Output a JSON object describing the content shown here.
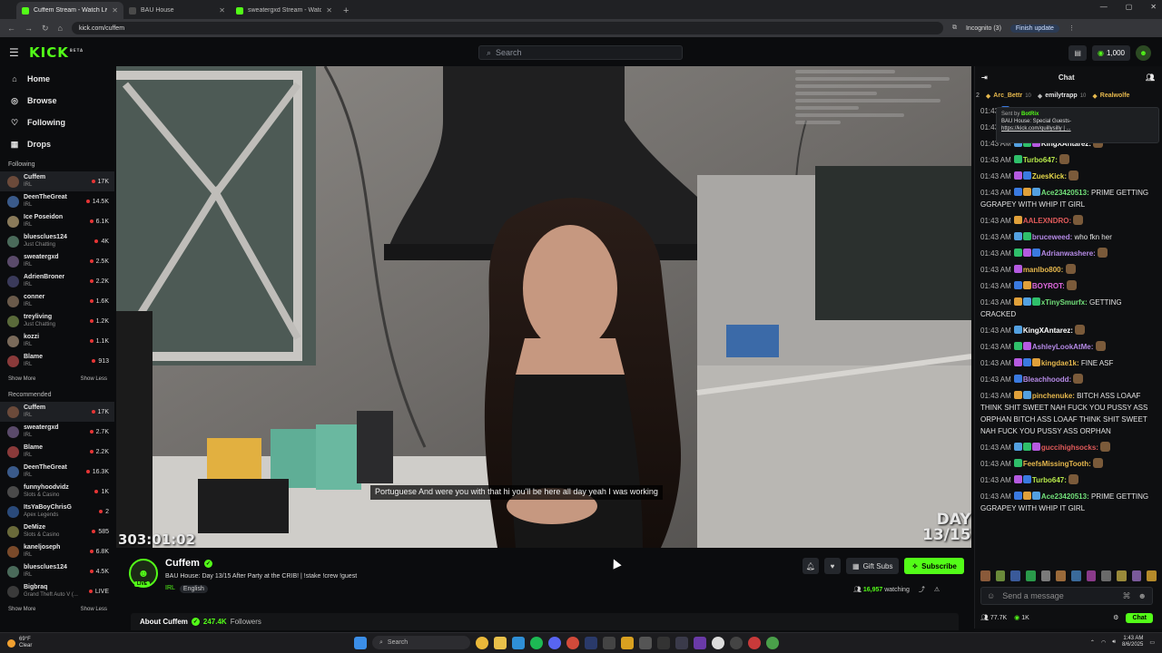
{
  "browser": {
    "tabs": [
      {
        "title": "Cuffem Stream - Watch Liv",
        "active": true
      },
      {
        "title": "BAU House",
        "active": false
      },
      {
        "title": "sweatergxd Stream - Watch Liv",
        "active": false
      }
    ],
    "url": "kick.com/cuffem",
    "incognito": "Incognito (3)",
    "update": "Finish update"
  },
  "header": {
    "logo": "KICK",
    "logo_sup": "BETA",
    "search_placeholder": "Search",
    "coins": "1,000"
  },
  "sidebar": {
    "nav": [
      {
        "label": "Home",
        "icon": "home-icon"
      },
      {
        "label": "Browse",
        "icon": "compass-icon"
      },
      {
        "label": "Following",
        "icon": "heart-icon"
      },
      {
        "label": "Drops",
        "icon": "gift-icon"
      }
    ],
    "following_title": "Following",
    "following": [
      {
        "name": "Cuffem",
        "category": "IRL",
        "viewers": "17K",
        "color": "#6b4a3a"
      },
      {
        "name": "DeenTheGreat",
        "category": "IRL",
        "viewers": "14.5K",
        "color": "#3a5a8a"
      },
      {
        "name": "Ice Poseidon",
        "category": "IRL",
        "viewers": "6.1K",
        "color": "#8a7a5a"
      },
      {
        "name": "bluesclues124",
        "category": "Just Chatting",
        "viewers": "4K",
        "color": "#4a6a5a"
      },
      {
        "name": "sweatergxd",
        "category": "IRL",
        "viewers": "2.5K",
        "color": "#5a4a6a"
      },
      {
        "name": "AdrienBroner",
        "category": "IRL",
        "viewers": "2.2K",
        "color": "#3a3a5a"
      },
      {
        "name": "conner",
        "category": "IRL",
        "viewers": "1.6K",
        "color": "#6a5a4a"
      },
      {
        "name": "treyliving",
        "category": "Just Chatting",
        "viewers": "1.2K",
        "color": "#5a6a3a"
      },
      {
        "name": "kozzi",
        "category": "IRL",
        "viewers": "1.1K",
        "color": "#7a6a5a"
      },
      {
        "name": "Blame",
        "category": "IRL",
        "viewers": "913",
        "color": "#8a3a3a"
      }
    ],
    "show_more": "Show More",
    "show_less": "Show Less",
    "recommended_title": "Recommended",
    "recommended": [
      {
        "name": "Cuffem",
        "category": "IRL",
        "viewers": "17K",
        "color": "#6b4a3a"
      },
      {
        "name": "sweatergxd",
        "category": "IRL",
        "viewers": "2.7K",
        "color": "#5a4a6a"
      },
      {
        "name": "Blame",
        "category": "IRL",
        "viewers": "2.2K",
        "color": "#8a3a3a"
      },
      {
        "name": "DeenTheGreat",
        "category": "IRL",
        "viewers": "16.3K",
        "color": "#3a5a8a"
      },
      {
        "name": "funnyhoodvidz",
        "category": "Slots & Casino",
        "viewers": "1K",
        "color": "#4a4a4a"
      },
      {
        "name": "ItsYaBoyChrisG",
        "category": "Apex Legends",
        "viewers": "2",
        "color": "#2a4a7a"
      },
      {
        "name": "DeMize",
        "category": "Slots & Casino",
        "viewers": "585",
        "color": "#6a6a3a"
      },
      {
        "name": "kaneljoseph",
        "category": "IRL",
        "viewers": "6.8K",
        "color": "#7a4a2a"
      },
      {
        "name": "bluesclues124",
        "category": "IRL",
        "viewers": "4.5K",
        "color": "#4a6a5a"
      },
      {
        "name": "Bigbraq",
        "category": "Grand Theft Auto V (...",
        "viewers": "LIVE",
        "color": "#3a3a3a"
      }
    ]
  },
  "video": {
    "caption": "Portuguese And were you with that hi you'll be here all day yeah I was working",
    "timer": "303:01:02",
    "day_overlay": [
      "DAY",
      "13/15"
    ]
  },
  "stream": {
    "name": "Cuffem",
    "live_badge": "LIVE",
    "title": "BAU House: Day 13/15 After Party at the CRIB! | !stake !crew !guest",
    "category": "IRL",
    "language": "English",
    "gift_subs": "Gift Subs",
    "subscribe": "Subscribe",
    "watching_count": "16,957",
    "watching_label": "watching",
    "about_label": "About Cuffem",
    "followers_count": "247.4K",
    "followers_label": "Followers"
  },
  "chat": {
    "title": "Chat",
    "gifter_rank": "2",
    "gifters": [
      {
        "name": "Arc_Bettr",
        "count": "10",
        "color": "#e6b84d"
      },
      {
        "name": "emilytrapp",
        "count": "10",
        "color": "#e6e6e6"
      },
      {
        "name": "Realwolfe",
        "count": "",
        "color": "#e6b84d"
      }
    ],
    "pinned": {
      "sent_by": "Sent by",
      "bot": "BotRix",
      "text": "BAU House: Special Guests-",
      "link": "https://kick.com/quillysilly | ..."
    },
    "messages": [
      {
        "time": "01:43",
        "user": "",
        "text": "THE",
        "color": "#e3e3e3"
      },
      {
        "time": "01:43 AM",
        "user": "",
        "text": "",
        "color": "#e3e3e3"
      },
      {
        "time": "01:43 AM",
        "user": "KingXAntarez:",
        "text": "",
        "color": "#ffffff"
      },
      {
        "time": "01:43 AM",
        "user": "Turbo647:",
        "text": "",
        "color": "#b6e84a"
      },
      {
        "time": "01:43 AM",
        "user": "ZuesKick:",
        "text": "",
        "color": "#e6d84a"
      },
      {
        "time": "01:43 AM",
        "user": "Ace23420513:",
        "text": "PRIME GETTING GGRAPEY WITH WHIP IT GIRL",
        "color": "#72e07a"
      },
      {
        "time": "01:43 AM",
        "user": "AALEXNDRO:",
        "text": "",
        "color": "#e05a5a"
      },
      {
        "time": "01:43 AM",
        "user": "bruceweed:",
        "text": "who fkn her",
        "color": "#b58ae6"
      },
      {
        "time": "01:43 AM",
        "user": "Adrianwashere:",
        "text": "",
        "color": "#b58ae6"
      },
      {
        "time": "01:43 AM",
        "user": "manlbo800:",
        "text": "",
        "color": "#e6b84d"
      },
      {
        "time": "01:43 AM",
        "user": "BOYROT:",
        "text": "",
        "color": "#e06ae0"
      },
      {
        "time": "01:43 AM",
        "user": "xTinySmurfx:",
        "text": "GETTING CRACKED",
        "color": "#72e07a"
      },
      {
        "time": "01:43 AM",
        "user": "KingXAntarez:",
        "text": "",
        "color": "#ffffff"
      },
      {
        "time": "01:43 AM",
        "user": "AshleyLookAtMe:",
        "text": "",
        "color": "#b58ae6"
      },
      {
        "time": "01:43 AM",
        "user": "kingdae1k:",
        "text": "FINE ASF",
        "color": "#e6b84d"
      },
      {
        "time": "01:43 AM",
        "user": "Bleachhoodd:",
        "text": "",
        "color": "#b58ae6"
      },
      {
        "time": "01:43 AM",
        "user": "pinchenuke:",
        "text": "BITCH ASS LOAAF THINK SHIT SWEET NAH FUCK YOU PUSSY ASS ORPHAN BITCH ASS LOAAF THINK SHIT SWEET NAH FUCK YOU PUSSY ASS ORPHAN",
        "color": "#e6b84d"
      },
      {
        "time": "01:43 AM",
        "user": "guccihighsocks:",
        "text": "",
        "color": "#e05a5a"
      },
      {
        "time": "01:43 AM",
        "user": "FeefsMissingTooth:",
        "text": "",
        "color": "#e6b84d"
      },
      {
        "time": "01:43 AM",
        "user": "Turbo647:",
        "text": "",
        "color": "#b6e84a"
      },
      {
        "time": "01:43 AM",
        "user": "Ace23420513:",
        "text": "PRIME GETTING GGRAPEY WITH WHIP IT GIRL",
        "color": "#72e07a"
      }
    ],
    "emote_colors": [
      "#8a5a3a",
      "#6a8a3a",
      "#3a5a9a",
      "#2a9a4a",
      "#7a7a7a",
      "#9a6a3a",
      "#3a6a9a",
      "#8a3a8a",
      "#6a6a6a",
      "#9a8a3a",
      "#7a5a9a",
      "#b58a2a"
    ],
    "send_placeholder": "Send a message",
    "footer_count1": "77.7K",
    "footer_count2": "1K",
    "chat_button": "Chat"
  },
  "taskbar": {
    "weather_temp": "69°F",
    "weather_desc": "Clear",
    "search": "Search",
    "time": "1:43 AM",
    "date": "8/6/2025"
  }
}
